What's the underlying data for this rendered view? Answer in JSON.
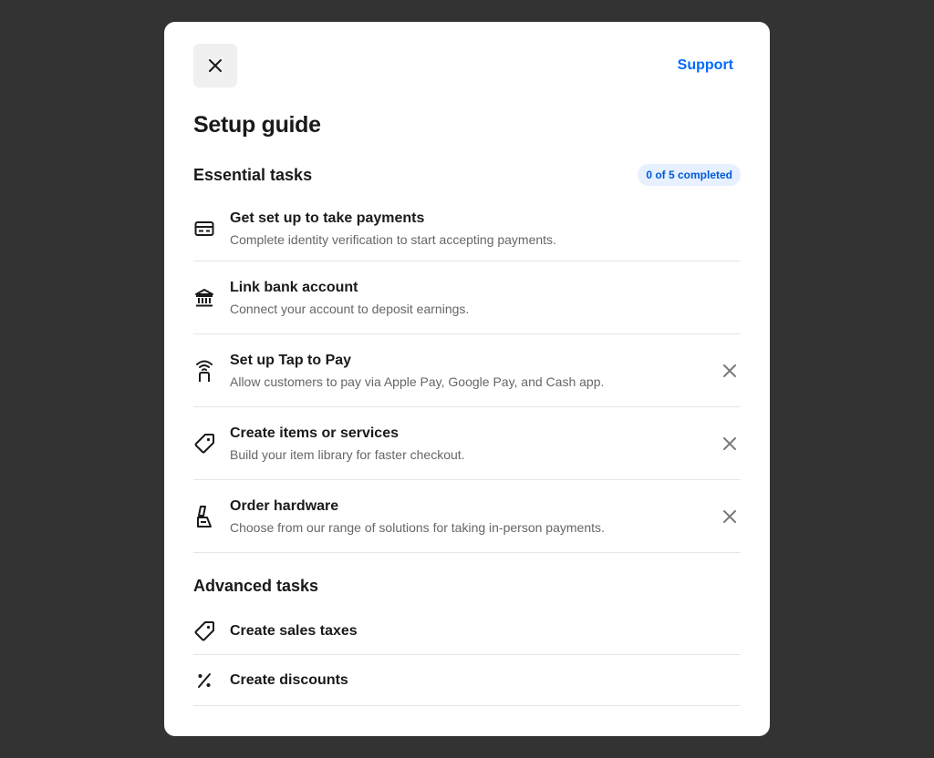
{
  "header": {
    "support_label": "Support",
    "title": "Setup guide"
  },
  "essential": {
    "title": "Essential tasks",
    "progress_badge": "0 of 5 completed",
    "tasks": [
      {
        "title": "Get set up to take payments",
        "desc": "Complete identity verification to start accepting payments.",
        "icon": "credit-card-icon",
        "dismissible": false
      },
      {
        "title": "Link bank account",
        "desc": "Connect your account to deposit earnings.",
        "icon": "bank-icon",
        "dismissible": false
      },
      {
        "title": "Set up Tap to Pay",
        "desc": "Allow customers to pay via Apple Pay, Google Pay, and Cash app.",
        "icon": "tap-to-pay-icon",
        "dismissible": true
      },
      {
        "title": "Create items or services",
        "desc": "Build your item library for faster checkout.",
        "icon": "tag-icon",
        "dismissible": true
      },
      {
        "title": "Order hardware",
        "desc": "Choose from our range of solutions for taking in-person payments.",
        "icon": "hardware-icon",
        "dismissible": true
      }
    ]
  },
  "advanced": {
    "title": "Advanced tasks",
    "tasks": [
      {
        "title": "Create sales taxes",
        "icon": "tag-icon"
      },
      {
        "title": "Create discounts",
        "icon": "percent-icon"
      }
    ]
  },
  "colors": {
    "accent": "#006aff",
    "backdrop": "#333333",
    "badge_bg": "#e6f0ff"
  }
}
